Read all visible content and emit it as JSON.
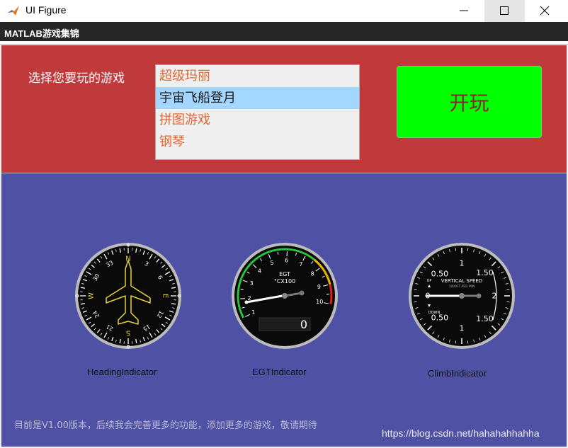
{
  "window": {
    "title": "UI Figure",
    "icon": "matlab-icon",
    "controls": [
      "minimize-icon",
      "maximize-icon",
      "close-icon"
    ]
  },
  "menubar": {
    "title": "MATLAB游戏集锦"
  },
  "game_select": {
    "prompt": "选择您要玩的游戏",
    "items": [
      "超级玛丽",
      "宇宙飞船登月",
      "拼图游戏",
      "钢琴"
    ],
    "selected_index": 1
  },
  "play_button": {
    "label": "开玩"
  },
  "gauges": {
    "heading": {
      "label": "HeadingIndicator",
      "compass_labels": [
        "N",
        "3",
        "6",
        "E",
        "12",
        "15",
        "S",
        "21",
        "24",
        "W",
        "30",
        "33"
      ]
    },
    "egt": {
      "label": "EGTIndicator",
      "title": "EGT",
      "unit": "°CX100",
      "scale": [
        "1",
        "2",
        "3",
        "4",
        "5",
        "6",
        "7",
        "8",
        "9",
        "10"
      ],
      "readout": "0"
    },
    "climb": {
      "label": "ClimbIndicator",
      "title": "VERTICAL SPEED",
      "subtitle": "1000FT PER MIN",
      "up_label": "UP",
      "down_label": "DOWN",
      "scale": [
        "0",
        "0.50",
        "1",
        "1.50",
        "2",
        "1.50",
        "1",
        "0.50"
      ]
    }
  },
  "footer": {
    "version_text": "目前是V1.00版本，后续我会完善更多的功能，添加更多的游戏，敬请期待",
    "watermark": "https://blog.csdn.net/hahahahhahha"
  },
  "colors": {
    "top_panel": "#c0393b",
    "bottom_panel": "#4f52a4",
    "play_button": "#00ff00",
    "play_text": "#8b2432",
    "list_text": "#e1683a",
    "list_selected": "#a3d7ff"
  }
}
